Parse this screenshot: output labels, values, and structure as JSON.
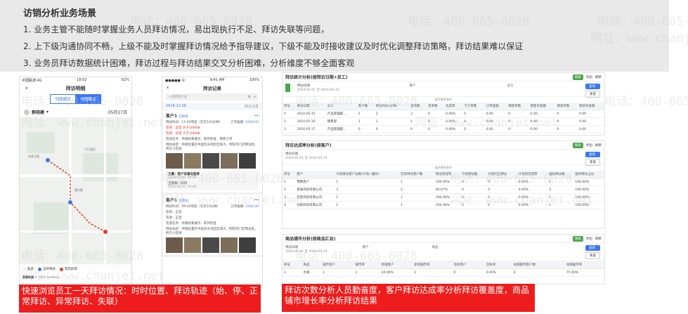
{
  "header": {
    "title": "访销分析业务场景",
    "lines": [
      "1.  业务主管不能随时掌握业务人员拜访情况，易出现执行不足、拜访失联等问题，",
      "2.  上下级沟通协同不畅，上级不能及时掌握拜访情况给予指导建议，下级不能及时接收建议及时优化调整拜访策略，拜访结果难以保证",
      "3.  业务员拜访数据统计困难，拜访过程与拜访结果交叉分析困难，分析维度不够全面客观"
    ]
  },
  "watermarks": {
    "phone": "电话：400-665-0028",
    "site": "网址：www.chanjet.net"
  },
  "phone1": {
    "status_left": "中国联通 4G",
    "status_time": "18:02",
    "status_right": "62%",
    "title": "拜访明细",
    "tab_list": "列表模式",
    "tab_map": "地图模式",
    "user_name": "郭晓建",
    "user_date": "05月17日",
    "map_labels": [
      "安泰大厦",
      "工行园区",
      "高德地图",
      "嘉兴路"
    ],
    "legend": [
      "轨迹",
      "当日拜访",
      "签到异常"
    ],
    "footer": "© 2024 AutoNavi"
  },
  "phone2": {
    "status_left": "●●●●● 令",
    "status_time": "9:41 AM",
    "status_right": "100%",
    "title": "拜访记录",
    "search_placeholder": "搜索客户名",
    "date": "2019-12-06",
    "date_right": "拜访记录",
    "card1": {
      "name": "客户1",
      "tag": "已拜访",
      "visit_time": "拜访时间：13:00完成（在店120分钟）",
      "order_label": "订单金额:",
      "order_value": "1000.00",
      "sign_in": "签到：异常  大于1000米",
      "sign_out": "签退：异常  大于1000米",
      "items": "完成任务：终端形象展示、陈列检查、销售订单",
      "summary": "拜访总结：终端位置在中国华东地区区域大，所陈列门店拜访后，所在小区域"
    },
    "sub_comment": {
      "name": "王晨：客户有意向签单",
      "time": "2020-01-01 09:09",
      "reply": "王晓翔：好的",
      "reply_time": "2020-01-01 10:00"
    },
    "card2": {
      "name": "客户1",
      "tag": "已拜访",
      "visit_time": "拜访时间：09:00完成（在店10分钟）",
      "order_label": "订单金额:",
      "order_value": "1000.00",
      "sign_in": "签到：正常",
      "sign_out": "签退：正常",
      "items": "完成任务：终端形象展示、陈列检查",
      "summary": "拜访总结：终端位置在中国华东地区区域大，所陈列门店拜访后，所在小区域"
    }
  },
  "dash1": {
    "title": "拜访统计分析(按拜访日期+员工)",
    "actions": [
      "图表",
      "导出",
      "刷新"
    ],
    "filter_date": "拜访日期",
    "filter_range": "2024-05-01 至 2024-05-31",
    "filter_customer": "客户",
    "filter_employee": "员工",
    "search": "查询",
    "reset": "重置",
    "expand": "展开更多条件",
    "columns": [
      "序号",
      "拜访日期",
      "员工",
      "客户数",
      "拜访时长(分钟)",
      "签到数",
      "签单数",
      "达成率",
      "下订单数",
      "订单金额",
      "销售单数",
      "销售单金额",
      "销退单数",
      "销退单金额"
    ],
    "rows": [
      [
        "1",
        "2024-05-15",
        "产品管理部...",
        "2",
        "2",
        "2",
        "0",
        "0.00%",
        "0",
        "0.00",
        "0",
        "0.00",
        "0",
        "0.00"
      ],
      [
        "2",
        "2024-05-16",
        "销售部",
        "1",
        "1",
        "1",
        "0",
        "0.00%",
        "0",
        "0.00",
        "0",
        "0.00",
        "0",
        "0.00"
      ],
      [
        "3",
        "2024-05-17",
        "产品管理部...",
        "0",
        "0",
        "0",
        "0",
        "0.00%",
        "0",
        "0.00",
        "0",
        "0.00",
        "0",
        "0.00"
      ]
    ]
  },
  "dash2": {
    "title": "拜访达成率分析(按客户)",
    "filter_date": "拜访日期",
    "filter_range": "2024-05-01 至 2024-05-31",
    "search": "查询",
    "reset": "重置",
    "expand": "展开更多条件",
    "columns": [
      "序号",
      "客户",
      "计划拜访客户总数(计划+临时)",
      "实际拜访客户数",
      "拜访完成率",
      "计划拜访数",
      "计划内已拜访",
      "计划内完成率",
      "临时拜访数",
      "临时拜访占比"
    ],
    "rows": [
      [
        "1",
        "零散客户",
        "1",
        "1",
        "100.00%",
        "0",
        "0",
        "0.00%",
        "1",
        "100.00%"
      ],
      [
        "2",
        "星辰商贸有限公司",
        "3",
        "2",
        "66.67%",
        "0",
        "0",
        "0.00%",
        "3",
        "100.00%"
      ],
      [
        "3",
        "佳客商贸有限公司",
        "1",
        "1",
        "100.00%",
        "0",
        "0",
        "0.00%",
        "1",
        "100.00%"
      ],
      [
        "4",
        "创新商贸有限公司",
        "1",
        "1",
        "100.00%",
        "0",
        "0",
        "0.00%",
        "1",
        "100.00%"
      ]
    ]
  },
  "dash3": {
    "title": "商品铺市分析(按商品汇总)",
    "filter_date": "拜访日期",
    "filter_range": "2024-05-01 至 2024-05-31",
    "filter_customer": "客户",
    "filter_product": "商品",
    "search": "查询",
    "reset": "重置",
    "columns": [
      "序号",
      "商品",
      "铺市客户",
      "铺市率",
      "新增客户",
      "新增铺市率",
      "流失客户",
      "流失率",
      "本期铺市客户数",
      "本期铺市率"
    ],
    "rows": [
      [
        "1",
        "水果",
        "1",
        "1",
        "20.00%",
        "1",
        "0",
        "0.00%",
        "0",
        "75.00%"
      ]
    ]
  },
  "captions": {
    "left": "快速浏览员工一天拜访情况：时时位置、拜访轨迹（始、停、正常拜访、异常拜访、失联）",
    "right": "拜访次数分析人员勤奋度，客户拜访达成率分析拜访覆盖度，商品铺市增长率分析拜访结果"
  },
  "colors": {
    "accent": "#3a78f2",
    "caption_bg": "#ee1c1c",
    "header_bg": "#e9e9e9",
    "green": "#4aa64a"
  }
}
